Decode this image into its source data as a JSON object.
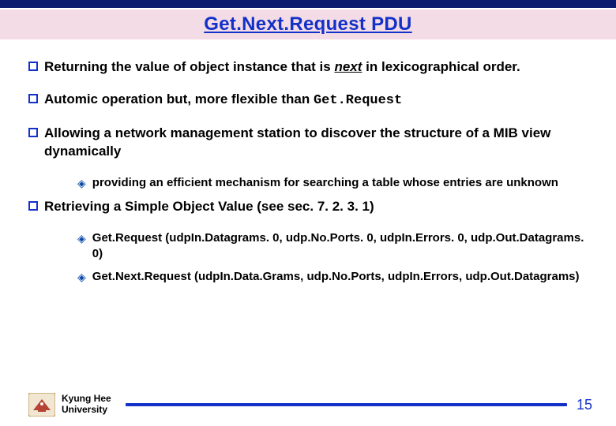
{
  "title": "Get.Next.Request PDU",
  "bullets": [
    {
      "pre": "Returning the value of object instance that is ",
      "next": "next",
      "post": " in lexicographical order."
    },
    {
      "pre": "Automic operation but, more flexible than ",
      "mono": "Get.Request"
    },
    {
      "text": "Allowing a network management station to discover the structure of a MIB view dynamically",
      "subs": [
        {
          "text": "providing an efficient mechanism for searching a table whose entries are unknown"
        }
      ]
    },
    {
      "text": "Retrieving a Simple Object Value (see sec. 7. 2. 3. 1)",
      "subs": [
        {
          "text": "Get.Request (udpIn.Datagrams. 0, udp.No.Ports. 0, udpIn.Errors. 0, udp.Out.Datagrams. 0)"
        },
        {
          "text": "Get.Next.Request (udpIn.Data.Grams,  udp.No.Ports, udpIn.Errors, udp.Out.Datagrams)"
        }
      ]
    }
  ],
  "footer": {
    "university_line1": "Kyung Hee",
    "university_line2": "University",
    "page": "15"
  }
}
